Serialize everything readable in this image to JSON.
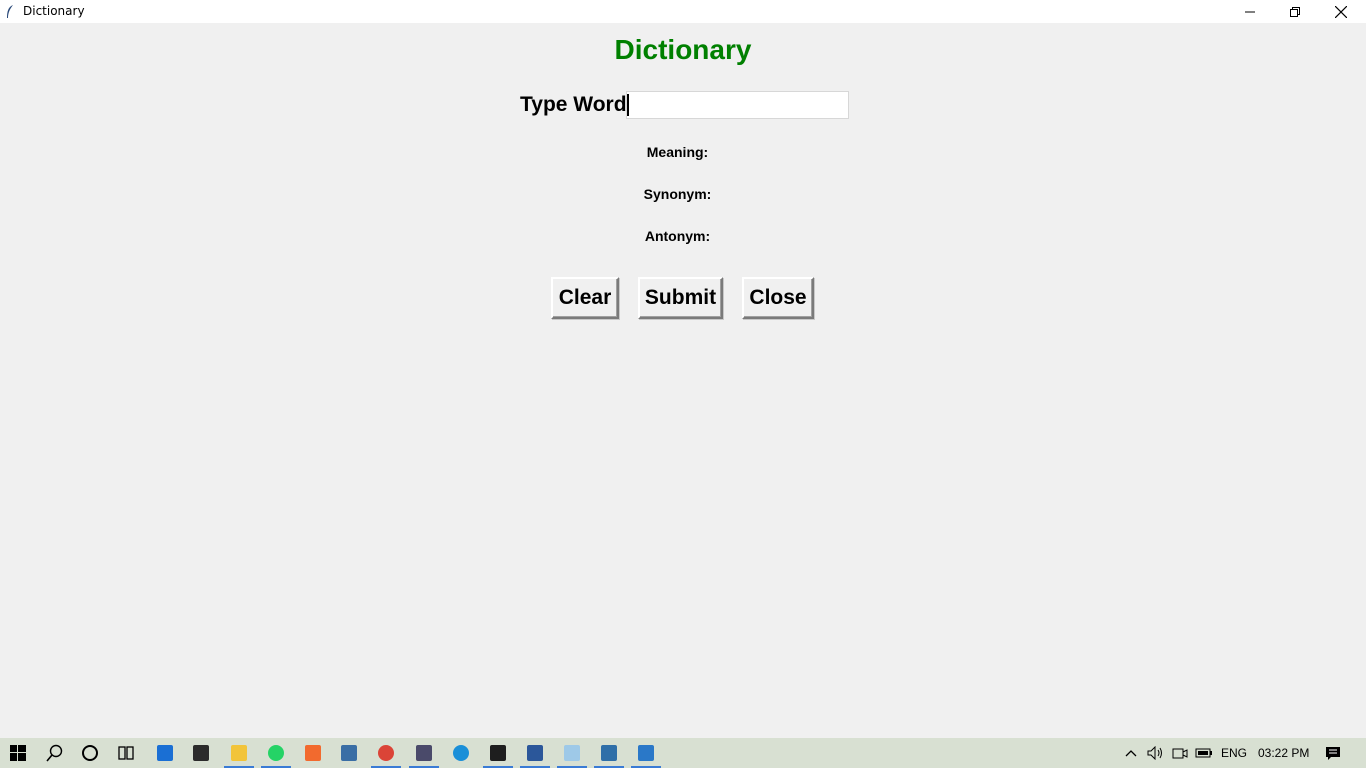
{
  "window": {
    "title": "Dictionary"
  },
  "app": {
    "heading": "Dictionary",
    "word_label": "Type Word",
    "word_value": "",
    "meaning_label": "Meaning:",
    "synonym_label": "Synonym:",
    "antonym_label": "Antonym:",
    "buttons": {
      "clear": "Clear",
      "submit": "Submit",
      "close": "Close"
    },
    "heading_color": "#008000"
  },
  "taskbar": {
    "apps": [
      {
        "name": "start-icon"
      },
      {
        "name": "search-icon"
      },
      {
        "name": "cortana-icon"
      },
      {
        "name": "task-view-icon"
      },
      {
        "name": "mail-icon"
      },
      {
        "name": "store-icon"
      },
      {
        "name": "file-explorer-icon"
      },
      {
        "name": "whatsapp-icon"
      },
      {
        "name": "app-orange-icon"
      },
      {
        "name": "python-icon"
      },
      {
        "name": "chrome-icon"
      },
      {
        "name": "settings-app-icon"
      },
      {
        "name": "edge-icon"
      },
      {
        "name": "terminal-icon"
      },
      {
        "name": "word-icon"
      },
      {
        "name": "notepad-icon"
      },
      {
        "name": "python-idle-icon"
      },
      {
        "name": "photos-icon"
      }
    ],
    "tray": {
      "language": "ENG",
      "time": "03:22 PM"
    }
  }
}
